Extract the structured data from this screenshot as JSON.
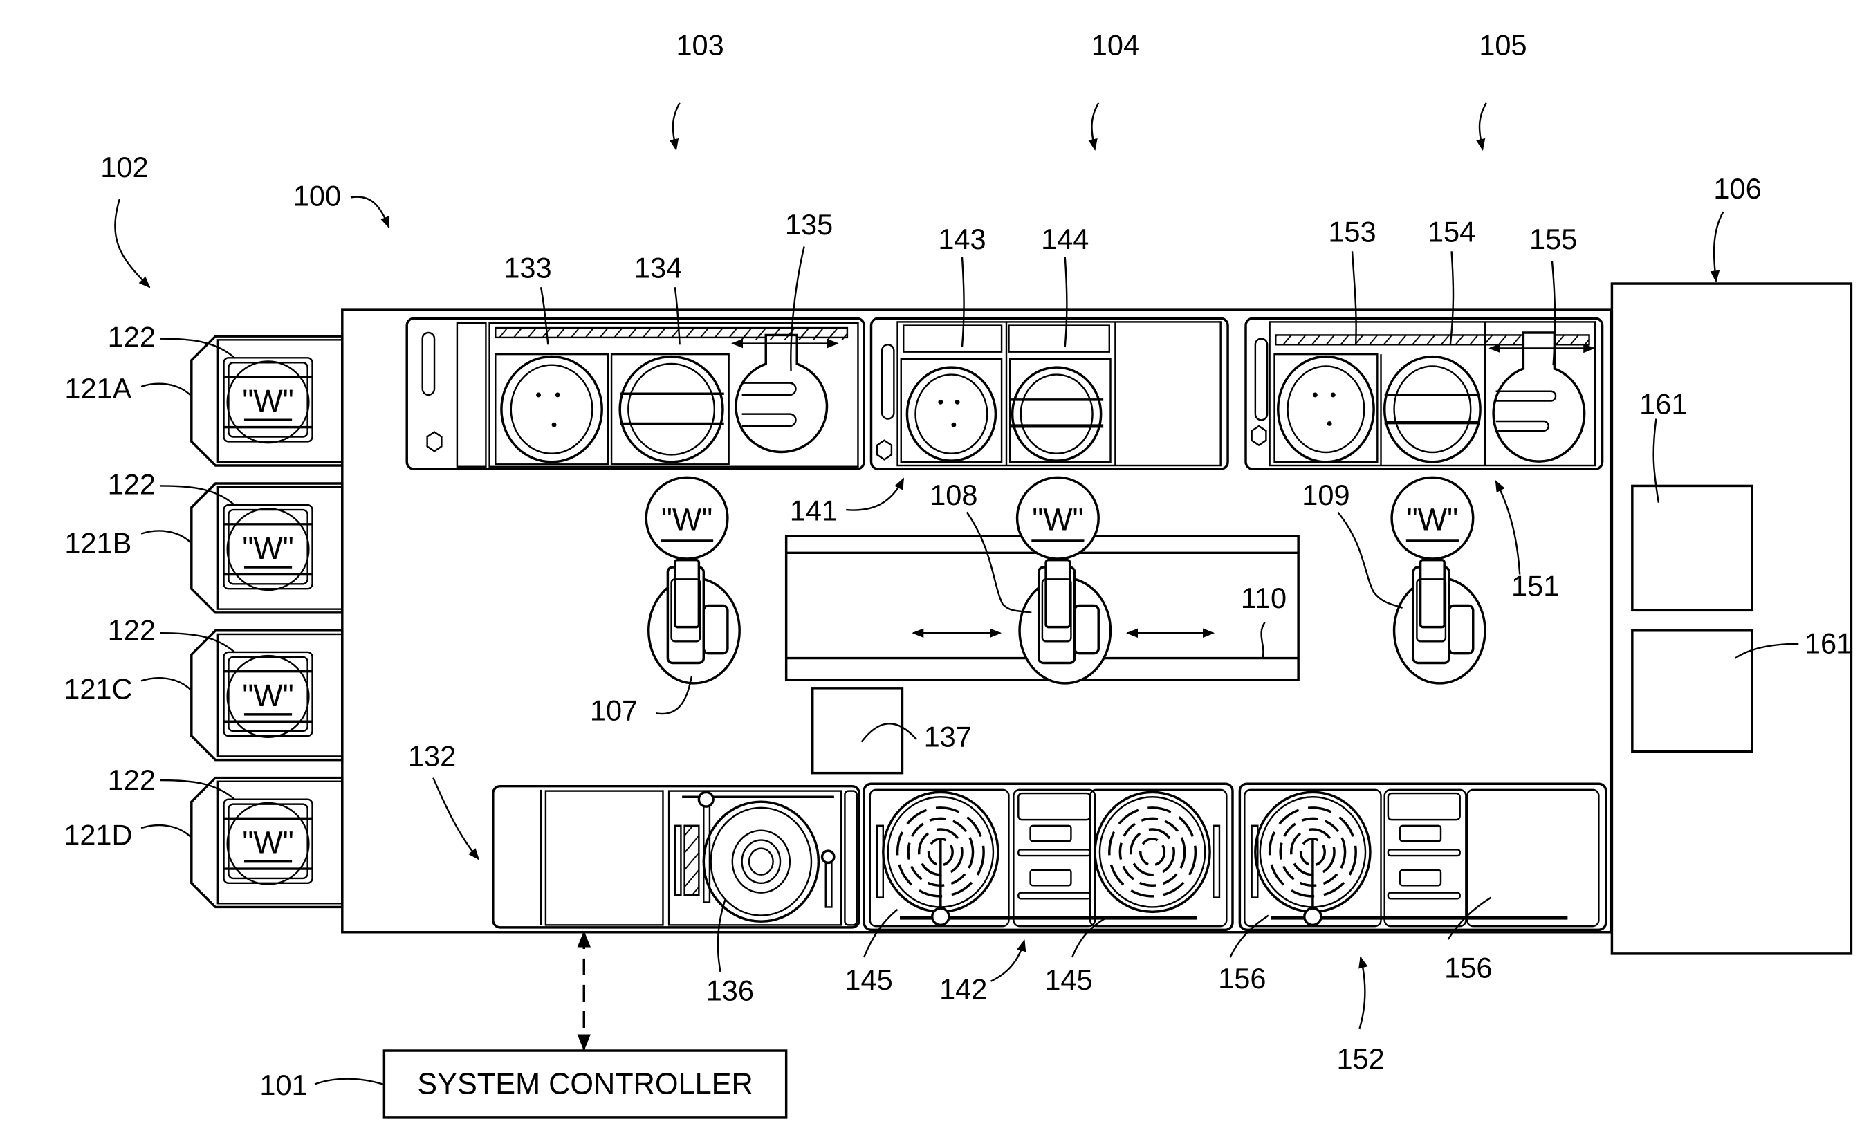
{
  "figure": {
    "type": "patent-style plan view of a substrate processing system",
    "colors": {
      "line": "#000000",
      "background": "#ffffff"
    }
  },
  "labels": {
    "system": "100",
    "controller_ref": "101",
    "factory_interface": "102",
    "module_a": "103",
    "module_b": "104",
    "module_c": "105",
    "module_right": "106",
    "robot_a": "107",
    "robot_b": "108",
    "robot_c": "109",
    "track": "110",
    "load_port_a": "121A",
    "load_port_b": "121B",
    "load_port_c": "121C",
    "load_port_d": "121D",
    "cassette": "122",
    "bottom_module_a": "132",
    "chamber_133": "133",
    "chamber_134": "134",
    "chamber_135": "135",
    "chamber_136": "136",
    "buffer_137": "137",
    "station_141": "141",
    "bottom_module_b": "142",
    "chamber_143": "143",
    "chamber_144": "144",
    "chamber_145": "145",
    "station_151": "151",
    "bottom_module_c": "152",
    "chamber_153": "153",
    "chamber_154": "154",
    "chamber_155": "155",
    "chamber_156": "156",
    "chamber_161": "161"
  },
  "wafer_mark": "\"W\"",
  "controller": {
    "label": "SYSTEM CONTROLLER"
  }
}
